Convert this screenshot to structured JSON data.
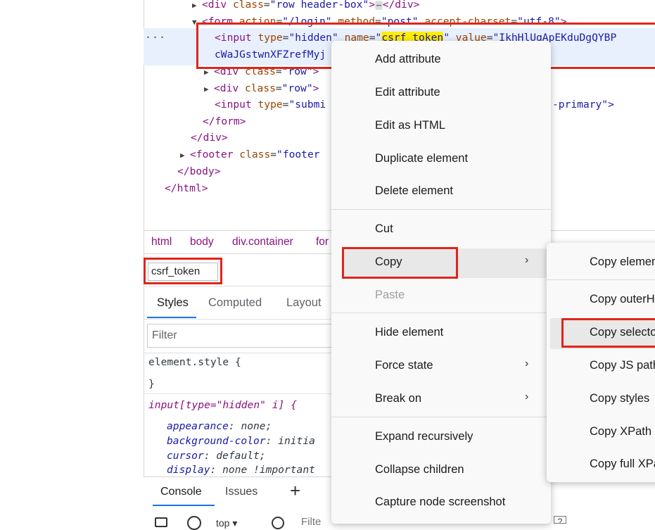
{
  "elements_tree": {
    "line1": {
      "tag_open": "<div ",
      "attr": "class",
      "eq": "=",
      "val": "\"row header-box\"",
      "close": ">",
      "ellipsis": "⋯",
      "end": "</div>"
    },
    "line2": {
      "tag_open": "<form ",
      "a1": "action",
      "v1": "\"/login\"",
      "a2": "method",
      "v2": "\"post\"",
      "a3": "accept-charset",
      "v3": "\"utf-8\"",
      "close": ">"
    },
    "line3": {
      "tag_open": "<input ",
      "a1": "type",
      "v1": "\"hidden\"",
      "a2": "name",
      "v2_q1": "\"",
      "v2": "csrf_token",
      "v2_q2": "\"",
      "a3": "value",
      "v3": "\"IkhHlUqApEKduDgQYBP"
    },
    "line4": {
      "text": "cWaJGstwnXFZrefMyj"
    },
    "line5": {
      "tag_open": "<div ",
      "attr": "class",
      "val": "\"row\"",
      "close": ">"
    },
    "line6": {
      "tag_open": "<div ",
      "attr": "class",
      "val": "\"row\"",
      "close": ">"
    },
    "line7": {
      "tag_open": "<input ",
      "attr": "type",
      "val": "\"submi",
      "tail": "-primary\">"
    },
    "line8": {
      "text": "</form>"
    },
    "line9": {
      "text": "</div>"
    },
    "line10": {
      "tag_open": "<footer ",
      "attr": "class",
      "val": "\"footer"
    },
    "line11": {
      "text": "</body>"
    },
    "line12": {
      "text": "</html>"
    },
    "dots": "···"
  },
  "breadcrumbs": [
    "html",
    "body",
    "div.container",
    "for"
  ],
  "search": {
    "value": "csrf_token"
  },
  "tabs": [
    "Styles",
    "Computed",
    "Layout"
  ],
  "filter": {
    "placeholder": "Filter"
  },
  "styles": {
    "rule1_selector": "element.style {",
    "rule1_close": "}",
    "rule2_selector": "input[type=\"hidden\" i] {",
    "props": [
      {
        "name": "appearance",
        "value": "none;"
      },
      {
        "name": "background-color",
        "value": "initia"
      },
      {
        "name": "cursor",
        "value": "default;"
      },
      {
        "name": "display",
        "value": "none !important"
      }
    ]
  },
  "drawer": {
    "console": "Console",
    "issues": "Issues",
    "add": "+",
    "filter": "Filte",
    "help": "?",
    "context": "top"
  },
  "context_menu": {
    "items": [
      "Add attribute",
      "Edit attribute",
      "Edit as HTML",
      "Duplicate element",
      "Delete element",
      "Cut",
      "Copy",
      "Paste",
      "Hide element",
      "Force state",
      "Break on",
      "Expand recursively",
      "Collapse children",
      "Capture node screenshot"
    ]
  },
  "submenu": {
    "items": [
      "Copy element",
      "Copy outerHTML",
      "Copy selector",
      "Copy JS path",
      "Copy styles",
      "Copy XPath",
      "Copy full XPath"
    ]
  },
  "colors": {
    "highlight_red": "#e0251b",
    "accent_blue": "#1a73e8",
    "tag_purple": "#881280"
  }
}
